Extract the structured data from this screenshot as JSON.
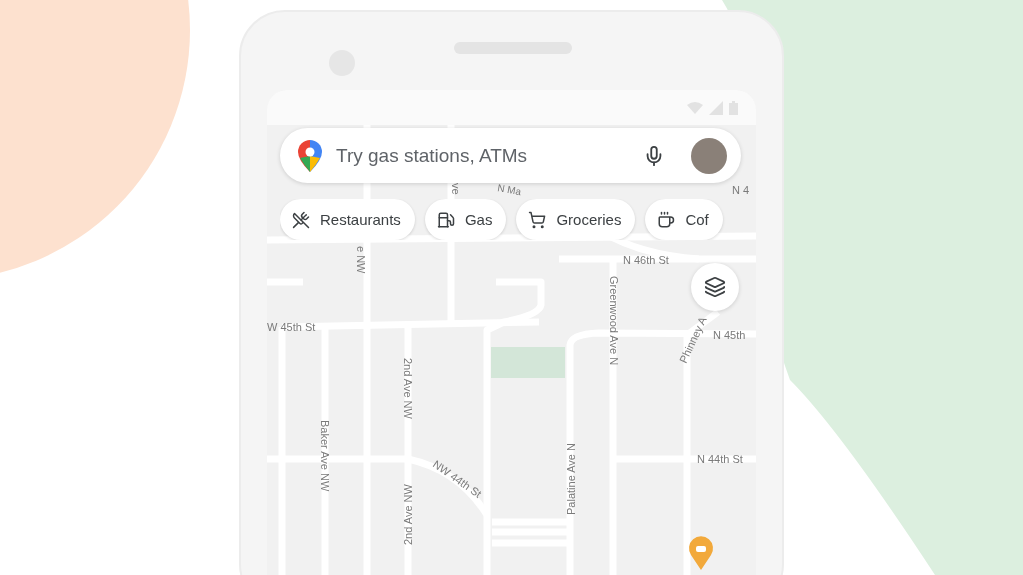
{
  "search": {
    "placeholder": "Try gas stations, ATMs"
  },
  "chips": [
    {
      "label": "Restaurants",
      "kind": "restaurant"
    },
    {
      "label": "Gas",
      "kind": "gas"
    },
    {
      "label": "Groceries",
      "kind": "groceries"
    },
    {
      "label": "Cof",
      "kind": "coffee"
    }
  ],
  "map": {
    "street_labels": [
      "N 4",
      "N Ma",
      "ve",
      "e NW",
      "N 46th St",
      "W 45th St",
      "Greenwood Ave N",
      "Phinney A",
      "N 45th",
      "2nd Ave NW",
      "Baker Ave NW",
      "NW 44th St",
      "N 44th St",
      "Palatine Ave N",
      "2nd Ave NW"
    ]
  }
}
